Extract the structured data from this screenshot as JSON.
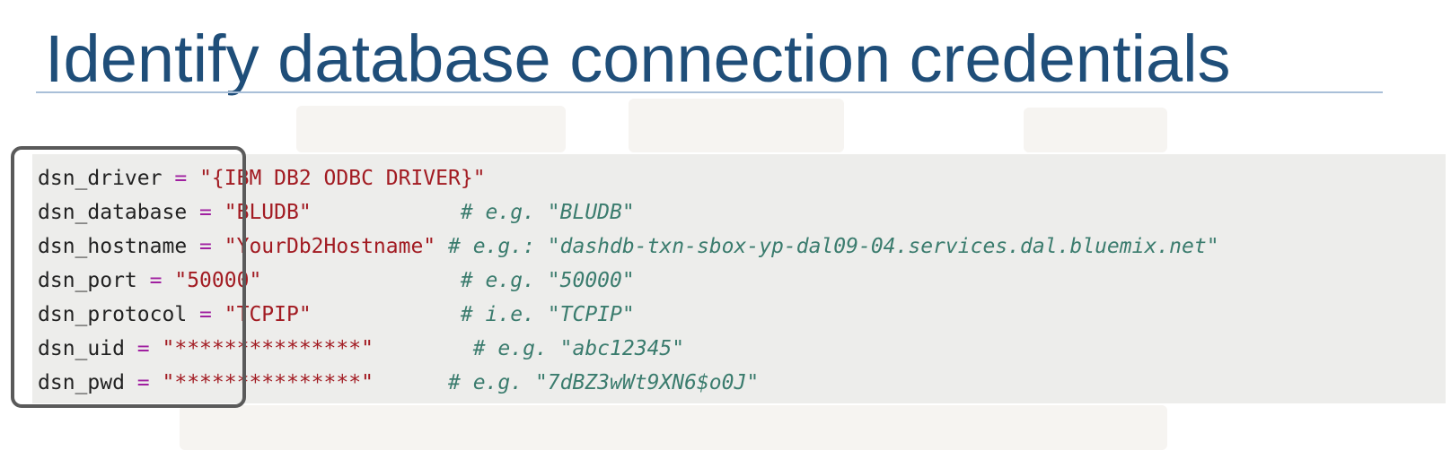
{
  "slide": {
    "title": "Identify database connection credentials"
  },
  "code": {
    "lines": [
      {
        "var": "dsn_driver",
        "op": "=",
        "value": "\"{IBM DB2 ODBC DRIVER}\"",
        "pad": "",
        "comment": ""
      },
      {
        "var": "dsn_database",
        "op": "=",
        "value": "\"BLUDB\"",
        "pad": "            ",
        "comment": "# e.g. \"BLUDB\""
      },
      {
        "var": "dsn_hostname",
        "op": "=",
        "value": "\"YourDb2Hostname\"",
        "pad": " ",
        "comment": "# e.g.: \"dashdb-txn-sbox-yp-dal09-04.services.dal.bluemix.net\""
      },
      {
        "var": "dsn_port",
        "op": "=",
        "value": "\"50000\"",
        "pad": "                ",
        "comment": "# e.g. \"50000\""
      },
      {
        "var": "dsn_protocol",
        "op": "=",
        "value": "\"TCPIP\"",
        "pad": "            ",
        "comment": "# i.e. \"TCPIP\""
      },
      {
        "var": "dsn_uid",
        "op": "=",
        "value": "\"***************\"",
        "pad": "        ",
        "comment": "# e.g. \"abc12345\""
      },
      {
        "var": "dsn_pwd",
        "op": "=",
        "value": "\"***************\"",
        "pad": "      ",
        "comment": "# e.g. \"7dBZ3wWt9XN6$o0J\""
      }
    ]
  },
  "colors": {
    "title": "#1f4e79",
    "code_background": "#ededeb",
    "operator": "#a020a0",
    "string": "#a21b22",
    "comment": "#3b7c6e",
    "highlight_border": "#5a5a5a"
  }
}
